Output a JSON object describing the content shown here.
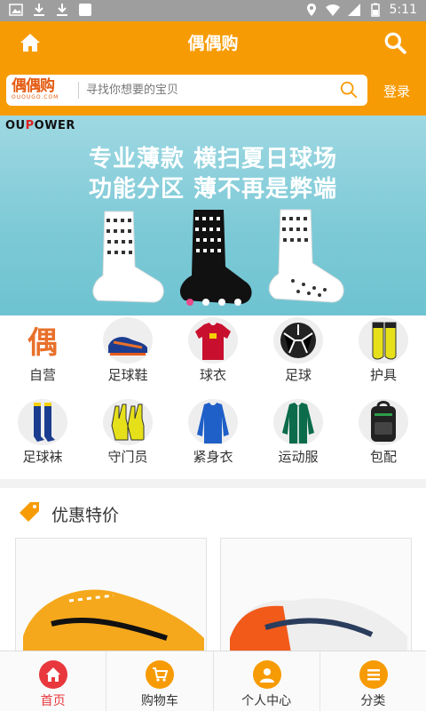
{
  "status_bar": {
    "time": "5:11"
  },
  "app_bar": {
    "title": "偶偶购"
  },
  "search": {
    "logo_text": "偶偶购",
    "logo_sub": "OUOUGO.COM",
    "placeholder": "寻找你想要的宝贝",
    "login_label": "登录"
  },
  "banner": {
    "brand_prefix": "OU",
    "brand_o": "P",
    "brand_rest": "OWER",
    "line1": "专业薄款  横扫夏日球场",
    "line2": "功能分区  薄不再是弊端",
    "slide_count": 4,
    "active_slide": 1
  },
  "categories": [
    {
      "label": "自营",
      "icon": "ou-logo-icon"
    },
    {
      "label": "足球鞋",
      "icon": "soccer-shoe-icon"
    },
    {
      "label": "球衣",
      "icon": "jersey-icon"
    },
    {
      "label": "足球",
      "icon": "soccer-ball-icon"
    },
    {
      "label": "护具",
      "icon": "shin-guard-icon"
    },
    {
      "label": "足球袜",
      "icon": "soccer-socks-icon"
    },
    {
      "label": "守门员",
      "icon": "goalkeeper-gloves-icon"
    },
    {
      "label": "紧身衣",
      "icon": "compression-shirt-icon"
    },
    {
      "label": "运动服",
      "icon": "tracksuit-icon"
    },
    {
      "label": "包配",
      "icon": "backpack-icon"
    }
  ],
  "deals": {
    "title": "优惠特价"
  },
  "tabs": [
    {
      "label": "首页",
      "icon": "home-icon"
    },
    {
      "label": "购物车",
      "icon": "cart-icon"
    },
    {
      "label": "个人中心",
      "icon": "user-icon"
    },
    {
      "label": "分类",
      "icon": "menu-icon"
    }
  ],
  "colors": {
    "primary": "#f79b04",
    "active": "#e8383d"
  }
}
